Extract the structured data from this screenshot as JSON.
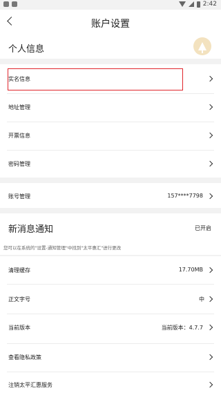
{
  "status_bar": {
    "time": "2:42",
    "icons": [
      "notification-square-icon",
      "notification-square-icon",
      "wifi-icon",
      "signal-icon",
      "battery-icon"
    ]
  },
  "header": {
    "title": "账户设置",
    "back_icon": "back-arrow-icon"
  },
  "personal_section": {
    "title": "个人信息",
    "avatar_icon": "tree-logo-icon"
  },
  "personal_items": [
    {
      "label": "实名信息"
    },
    {
      "label": "地址管理"
    },
    {
      "label": "开票信息"
    },
    {
      "label": "密码管理"
    }
  ],
  "account": {
    "label": "账号管理",
    "value": "157****7798"
  },
  "notice_section": {
    "title": "新消息通知",
    "status": "已开启",
    "tip": "您可以在系统的\"设置-通知管理\"中找到\"太平惠汇\"进行更改"
  },
  "settings_items": [
    {
      "label": "清理缓存",
      "value": "17.70MB"
    },
    {
      "label": "正文字号",
      "value": "中"
    },
    {
      "label": "当前版本",
      "value": "当前版本：4.7.7"
    },
    {
      "label": "查看隐私政策",
      "value": ""
    },
    {
      "label": "注销太平汇惠服务",
      "value": ""
    }
  ],
  "colors": {
    "highlight": "#e0242b",
    "section_gap": "#f2f2f2",
    "avatar_bg": "#f3e2bf"
  }
}
